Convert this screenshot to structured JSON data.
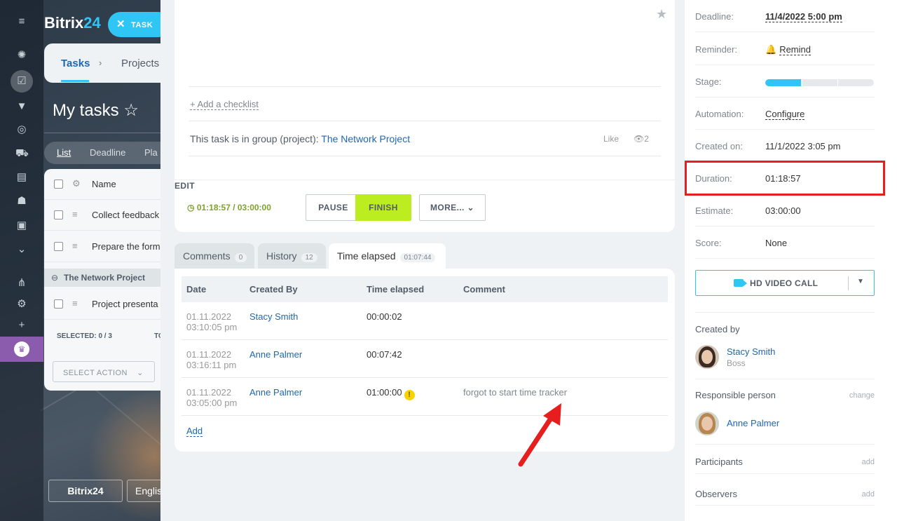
{
  "background": {
    "brand_name": "Bitrix",
    "brand_suffix": "24",
    "task_pill_label": "TASK",
    "breadcrumb": [
      "Tasks",
      "Projects"
    ],
    "page_title": "My tasks",
    "view_tabs": [
      "List",
      "Deadline",
      "Pla"
    ],
    "list_header": "Name",
    "list_items": [
      "Collect feedback",
      "Prepare the form"
    ],
    "group_name": "The Network Project",
    "group_item": "Project presenta",
    "selected_label": "SELECTED: 0 / 3",
    "selected_total": "TO",
    "select_action": "SELECT ACTION",
    "footer_logo": "Bitrix24",
    "footer_lang": "Englis",
    "rail_icons": [
      "menu-icon",
      "pulse-icon",
      "tasks-icon",
      "funnel-icon",
      "target-icon",
      "cart-icon",
      "contacts-icon",
      "robot-icon",
      "box-icon",
      "more-icon",
      "sitemap-icon",
      "settings-icon",
      "plus-icon",
      "crown-icon"
    ]
  },
  "task_card": {
    "add_checklist": "+ Add a checklist",
    "group_prefix": "This task is in group (project):",
    "group_link": "The Network Project",
    "like_label": "Like",
    "views_count": "2",
    "timer": "01:18:57 / 03:00:00",
    "pause_label": "PAUSE",
    "finish_label": "FINISH",
    "more_label": "MORE...",
    "edit_label": "EDIT"
  },
  "tabs": [
    {
      "label": "Comments",
      "count": "0"
    },
    {
      "label": "History",
      "count": "12"
    },
    {
      "label": "Time elapsed",
      "count": "01:07:44"
    }
  ],
  "time_table": {
    "headers": [
      "Date",
      "Created By",
      "Time elapsed",
      "Comment"
    ],
    "rows": [
      {
        "date": "01.11.2022",
        "time": "03:10:05 pm",
        "user": "Stacy Smith",
        "elapsed": "00:00:02",
        "comment": ""
      },
      {
        "date": "01.11.2022",
        "time": "03:16:11 pm",
        "user": "Anne Palmer",
        "elapsed": "00:07:42",
        "comment": ""
      },
      {
        "date": "01.11.2022",
        "time": "03:05:00 pm",
        "user": "Anne Palmer",
        "elapsed": "01:00:00",
        "comment": "forgot to start time tracker"
      }
    ],
    "add_label": "Add",
    "warning_glyph": "!"
  },
  "sidebar": {
    "deadline_label": "Deadline:",
    "deadline_value": "11/4/2022 5:00 pm",
    "reminder_label": "Reminder:",
    "reminder_value": "Remind",
    "stage_label": "Stage:",
    "stage_progress": 0.33,
    "automation_label": "Automation:",
    "automation_value": "Configure",
    "created_label": "Created on:",
    "created_value": "11/1/2022 3:05 pm",
    "duration_label": "Duration:",
    "duration_value": "01:18:57",
    "estimate_label": "Estimate:",
    "estimate_value": "03:00:00",
    "score_label": "Score:",
    "score_value": "None",
    "video_call_label": "HD VIDEO CALL",
    "created_by_label": "Created by",
    "creator_name": "Stacy Smith",
    "creator_role": "Boss",
    "responsible_label": "Responsible person",
    "responsible_action": "change",
    "responsible_name": "Anne Palmer",
    "participants_label": "Participants",
    "participants_action": "add",
    "observers_label": "Observers",
    "observers_action": "add"
  },
  "colors": {
    "accent": "#2fc6f6",
    "link": "#2067b0",
    "finish": "#bbed21",
    "highlight": "#e61e1e",
    "warning": "#f5d400"
  }
}
